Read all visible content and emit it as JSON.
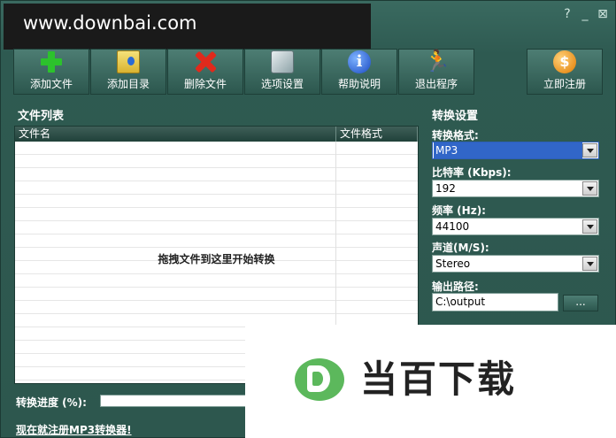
{
  "watermark": {
    "text": "www.downbai.com"
  },
  "window_controls": {
    "help": "?",
    "minimize": "_",
    "close": "⊠"
  },
  "toolbar": {
    "add_file": "添加文件",
    "add_dir": "添加目录",
    "delete_file": "删除文件",
    "options": "选项设置",
    "help": "帮助说明",
    "exit": "退出程序",
    "register": "立即注册"
  },
  "icons": {
    "add_file": "plus-icon",
    "add_dir": "folder-icon",
    "delete_file": "delete-icon",
    "options": "cube-icon",
    "help": "info-icon",
    "exit": "run-icon",
    "register": "coin-icon"
  },
  "file_list": {
    "title": "文件列表",
    "columns": [
      "文件名",
      "文件格式"
    ],
    "drop_hint": "拖拽文件到这里开始转换"
  },
  "settings": {
    "title": "转换设置",
    "format_label": "转换格式:",
    "format_value": "MP3",
    "bitrate_label": "比特率 (Kbps):",
    "bitrate_value": "192",
    "freq_label": "频率 (Hz):",
    "freq_value": "44100",
    "channel_label": "声道(M/S):",
    "channel_value": "Stereo",
    "output_label": "输出路径:",
    "output_value": "C:\\output",
    "browse_label": "..."
  },
  "progress": {
    "label": "转换进度 (%):",
    "value": 0
  },
  "register_link": "现在就注册MP3转换器!",
  "brand_watermark": {
    "text": "当百下载"
  },
  "colors": {
    "background": "#2f5a52",
    "accent": "#3166c8",
    "green": "#2cc22c"
  }
}
